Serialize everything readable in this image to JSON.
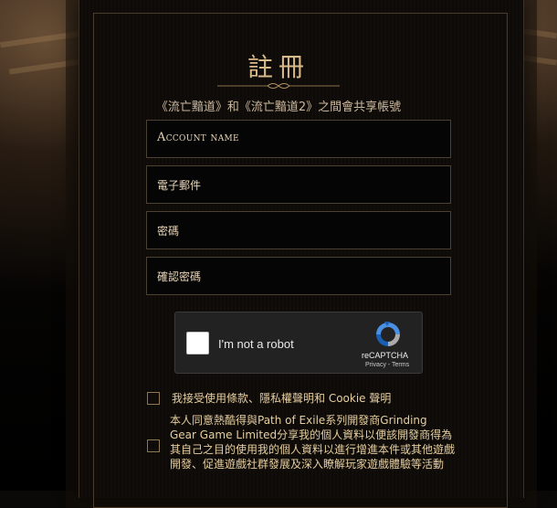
{
  "page": {
    "title": "註冊",
    "subtitle": "《流亡黯道》和《流亡黯道2》之間會共享帳號"
  },
  "form": {
    "account_name_placeholder": "Account name",
    "email_placeholder": "電子郵件",
    "password_placeholder": "密碼",
    "confirm_password_placeholder": "確認密碼"
  },
  "recaptcha": {
    "label": "I'm not a robot",
    "brand": "reCAPTCHA",
    "links": "Privacy - Terms"
  },
  "agreements": {
    "terms_text": "我接受使用條款、隱私權聲明和 Cookie 聲明",
    "consent_text": "本人同意熱酷得與Path of Exile系列開發商Grinding Gear Game Limited分享我的個人資料以便該開發商得為其自己之目的使用我的個人資料以進行增進本件或其他遊戲開發、促進遊戲社群發展及深入瞭解玩家遊戲體驗等活動"
  },
  "colors": {
    "accent_gold": "#d7b98a",
    "text_gold": "#e6cf9f",
    "field_border": "#4b4133"
  }
}
